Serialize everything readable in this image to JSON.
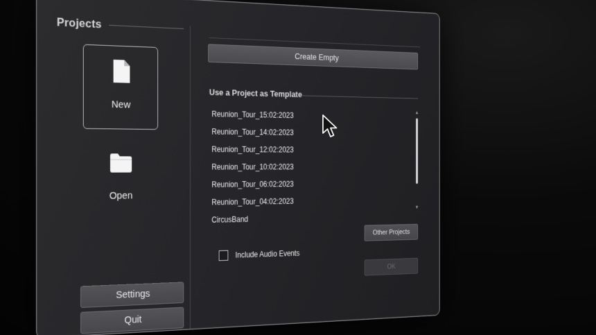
{
  "sidebar": {
    "title": "Projects",
    "new_label": "New",
    "open_label": "Open",
    "settings_label": "Settings",
    "quit_label": "Quit",
    "icons": {
      "new": "file-icon",
      "open": "folder-icon"
    }
  },
  "main": {
    "create_empty_label": "Create Empty",
    "template_section_title": "Use a Project as Template",
    "templates": [
      "Reunion_Tour_15:02:2023",
      "Reunion_Tour_14:02:2023",
      "Reunion_Tour_12:02:2023",
      "Reunion_Tour_10:02:2023",
      "Reunion_Tour_06:02:2023",
      "Reunion_Tour_04:02:2023",
      "CircusBand"
    ],
    "other_projects_label": "Other Projects",
    "include_audio_label": "Include Audio Events",
    "include_audio_checked": false,
    "ok_label": "OK"
  },
  "colors": {
    "window_bg": "#2a2a2d",
    "border": "#8a8a8e",
    "button_bg": "#4e4e52",
    "text": "#efeff0",
    "disabled_text": "#6a6a6e"
  }
}
